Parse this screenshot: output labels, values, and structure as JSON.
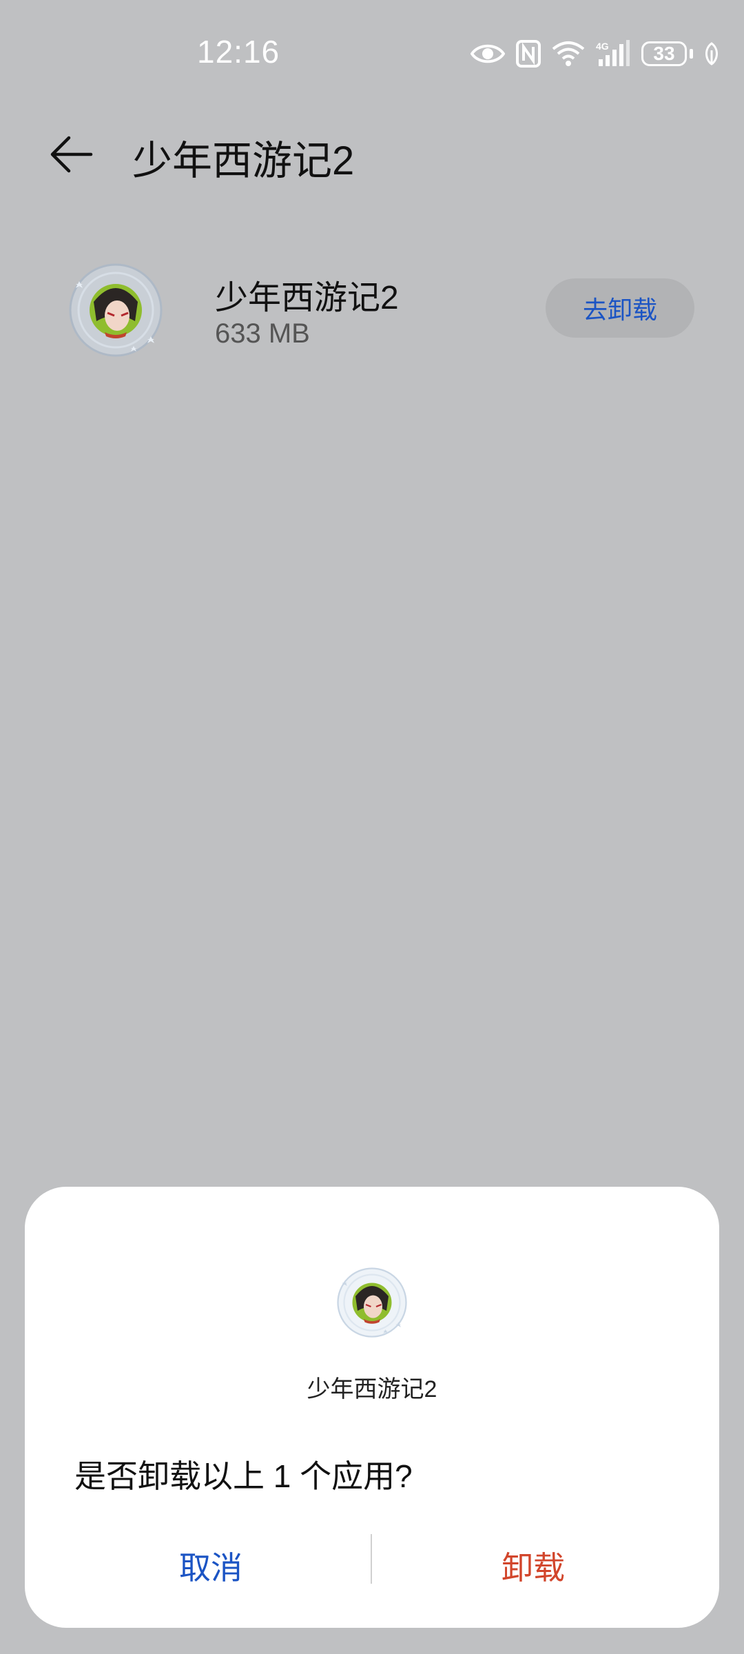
{
  "status_bar": {
    "time": "12:16",
    "battery_level": "33",
    "network": "4G",
    "icons": [
      "eye-icon",
      "nfc-icon",
      "wifi-icon",
      "cellular-4g-icon",
      "battery-icon",
      "leaf-icon"
    ]
  },
  "header": {
    "title": "少年西游记2",
    "back_icon": "back-arrow-icon"
  },
  "app_row": {
    "name": "少年西游记2",
    "size": "633 MB",
    "action_label": "去卸载"
  },
  "dialog": {
    "app_name": "少年西游记2",
    "message": "是否卸载以上 1 个应用?",
    "cancel_label": "取消",
    "confirm_label": "卸载"
  },
  "colors": {
    "background_dim": "#bfc0c2",
    "accent_blue": "#1b54c4",
    "danger_red": "#d2462c",
    "dialog_bg": "#ffffff"
  }
}
